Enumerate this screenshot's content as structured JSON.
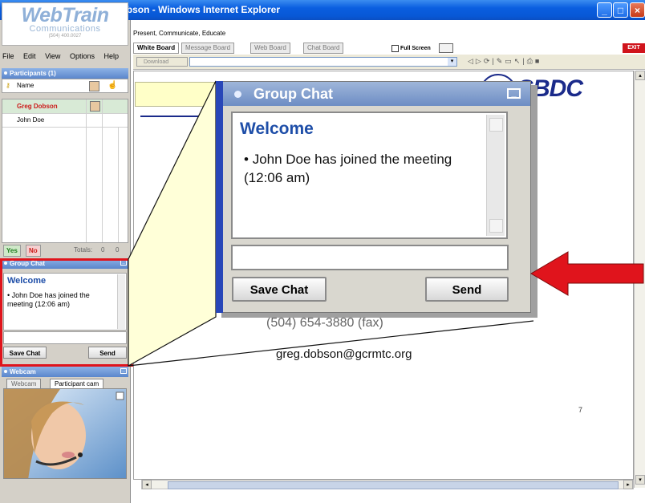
{
  "window": {
    "title": "AutoGen Test - Greg Dobson - Windows Internet Explorer"
  },
  "logo": {
    "brand": "WebTrain",
    "sub": "Communications",
    "phone": "(504) 400.0027"
  },
  "menu": [
    "File",
    "Edit",
    "View",
    "Options",
    "Help"
  ],
  "participants": {
    "header": "Participants (1)",
    "name_col": "Name",
    "rows": [
      "Greg Dobson",
      "John Doe"
    ],
    "yes": "Yes",
    "no": "No",
    "totals_label": "Totals:",
    "totals": [
      "0",
      "0"
    ]
  },
  "group_chat": {
    "header": "Group Chat",
    "welcome": "Welcome",
    "message": "John Doe has joined the meeting (12:06 am)",
    "save_label": "Save Chat",
    "send_label": "Send"
  },
  "webcam": {
    "header": "Webcam",
    "tabs": [
      "Webcam",
      "Participant cam"
    ]
  },
  "top": {
    "tagline": "Present, Communicate, Educate",
    "tabs": [
      "White Board",
      "Message Board",
      "Web Board",
      "Chat Board"
    ],
    "full_screen": "Full Screen",
    "exit": "EXIT",
    "download": "Download"
  },
  "board": {
    "logo": "SBDC",
    "fax": "(504) 654-3880 (fax)",
    "email": "greg.dobson@gcrmtc.org",
    "page_number": "7"
  },
  "colors": {
    "highlight": "#e0141c",
    "accent_blue": "#1e4ea8",
    "title_bar": "#0a5ee0"
  }
}
